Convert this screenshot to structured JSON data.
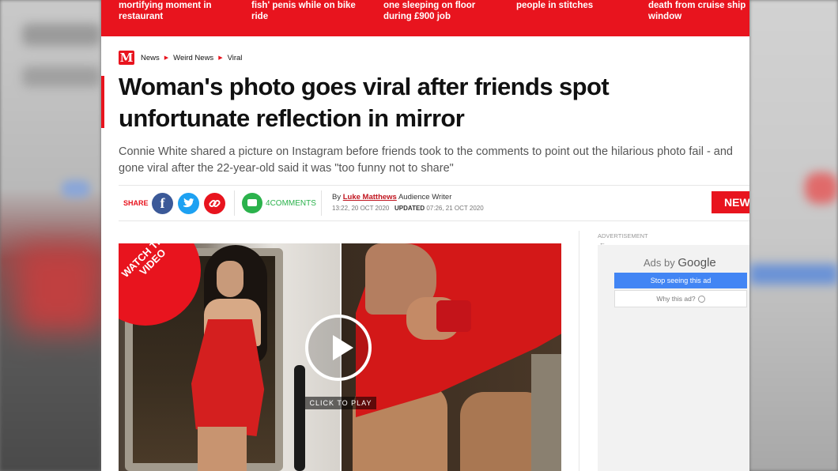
{
  "top_strip": [
    {
      "text": "mortifying moment in restaurant"
    },
    {
      "text": "fish' penis while on bike ride"
    },
    {
      "text": "one sleeping on floor during £900 job"
    },
    {
      "text": "people in stitches"
    },
    {
      "text": "death from cruise ship window"
    }
  ],
  "breadcrumb": {
    "logo": "M",
    "items": [
      "News",
      "Weird News",
      "Viral"
    ]
  },
  "article": {
    "headline": "Woman's photo goes viral after friends spot unfortunate reflection in mirror",
    "standfirst": "Connie White shared a picture on Instagram before friends took to the comments to point out the hilarious photo fail - and gone viral after the 22-year-old said it was \"too funny not to share\""
  },
  "share": {
    "label": "SHARE",
    "facebook_glyph": "f",
    "comments_count": "4",
    "comments_label": "COMMENTS"
  },
  "byline": {
    "by": "By",
    "author": "Luke Matthews",
    "role": "Audience Writer",
    "published": "13:22, 20 OCT 2020",
    "updated_label": "UPDATED",
    "updated": "07:26, 21 OCT 2020"
  },
  "news_button": "NEWS",
  "video": {
    "banner": "WATCH THE VIDEO",
    "click_label": "CLICK TO PLAY"
  },
  "ad": {
    "label": "ADVERTISEMENT",
    "back_arrow": "←",
    "ads_by": "Ads by",
    "google": "Google",
    "stop": "Stop seeing this ad",
    "why": "Why this ad?"
  },
  "colors": {
    "brand_red": "#e8141e",
    "facebook": "#3b5998",
    "twitter": "#1da1f2",
    "link": "#e8141e",
    "comments": "#2bb24c",
    "google_blue": "#4285f4"
  }
}
